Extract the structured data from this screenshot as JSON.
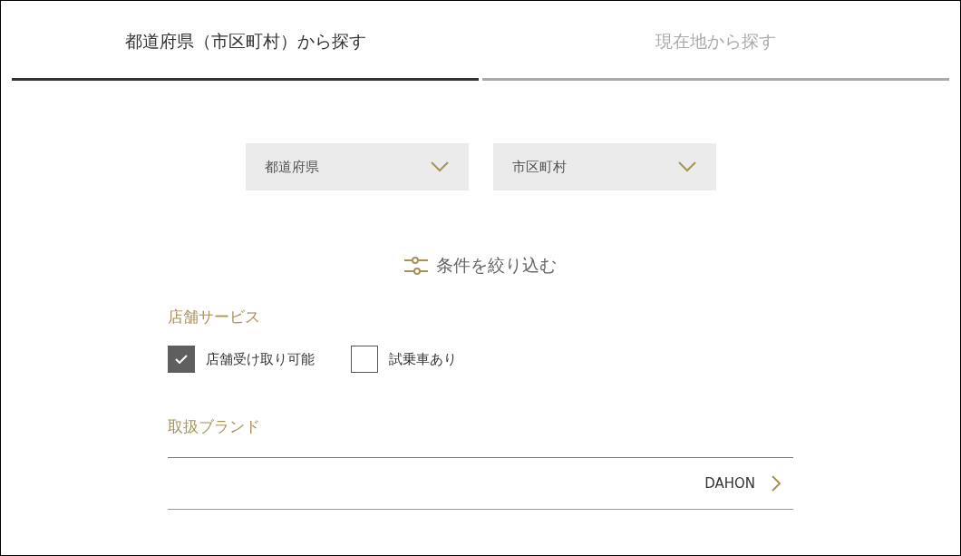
{
  "tabs": [
    {
      "label": "都道府県（市区町村）から探す",
      "selected": true
    },
    {
      "label": "現在地から探す",
      "selected": false
    }
  ],
  "selects": [
    {
      "placeholder": "都道府県"
    },
    {
      "placeholder": "市区町村"
    }
  ],
  "filter_toggle": {
    "label": "条件を絞り込む"
  },
  "store_services": {
    "heading": "店舗サービス",
    "options": [
      {
        "label": "店舗受け取り可能",
        "checked": true
      },
      {
        "label": "試乗車あり",
        "checked": false
      }
    ]
  },
  "brands": {
    "heading": "取扱ブランド",
    "items": [
      {
        "label": "DAHON"
      }
    ]
  }
}
